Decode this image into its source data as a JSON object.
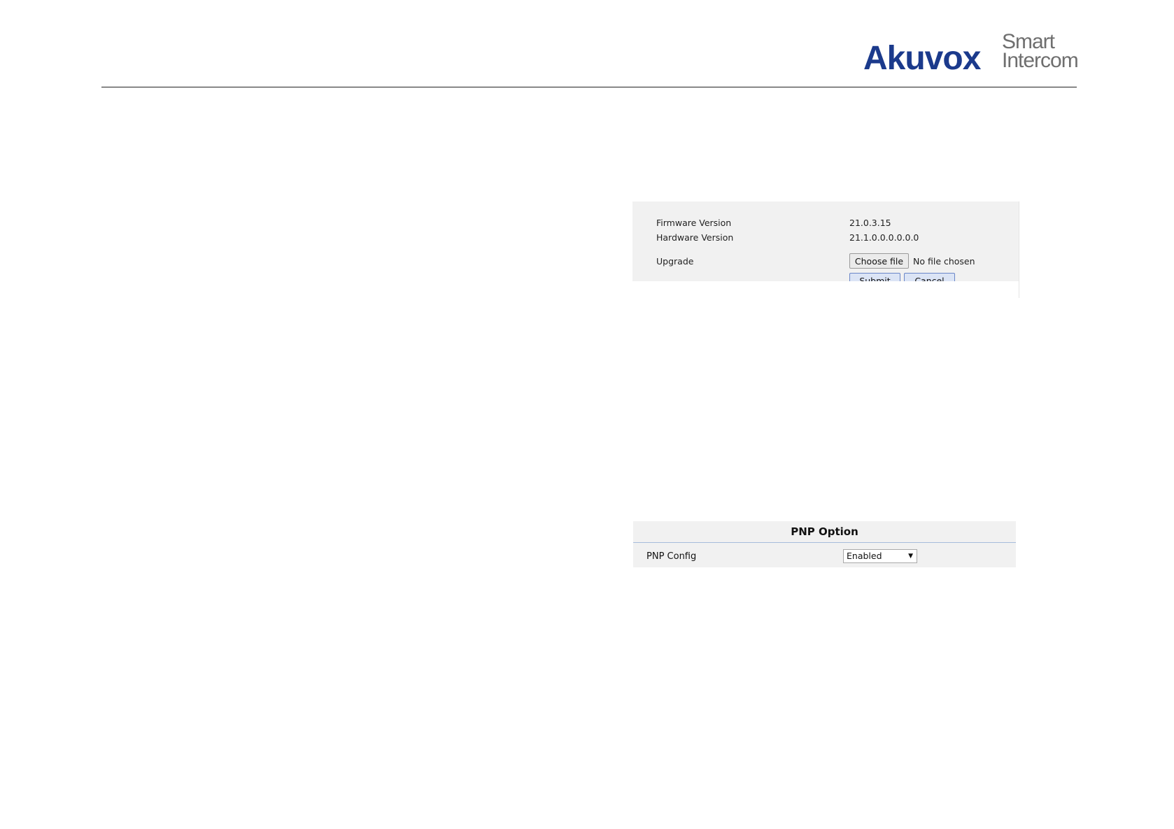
{
  "brand": {
    "name": "Akuvox",
    "tagline_line1": "Smart",
    "tagline_line2": "Intercom",
    "primary_color": "#1b3a8c",
    "secondary_color": "#6f6f6f"
  },
  "upgrade_panel": {
    "rows": [
      {
        "label": "Firmware Version",
        "value": "21.0.3.15"
      },
      {
        "label": "Hardware Version",
        "value": "21.1.0.0.0.0.0.0"
      }
    ],
    "upgrade_label": "Upgrade",
    "choose_file_label": "Choose file",
    "file_status": "No file chosen",
    "submit_label": "Submit",
    "cancel_label": "Cancel"
  },
  "pnp_panel": {
    "title": "PNP Option",
    "config_label": "PNP Config",
    "config_value": "Enabled",
    "accent_color": "#a6bcdc"
  }
}
